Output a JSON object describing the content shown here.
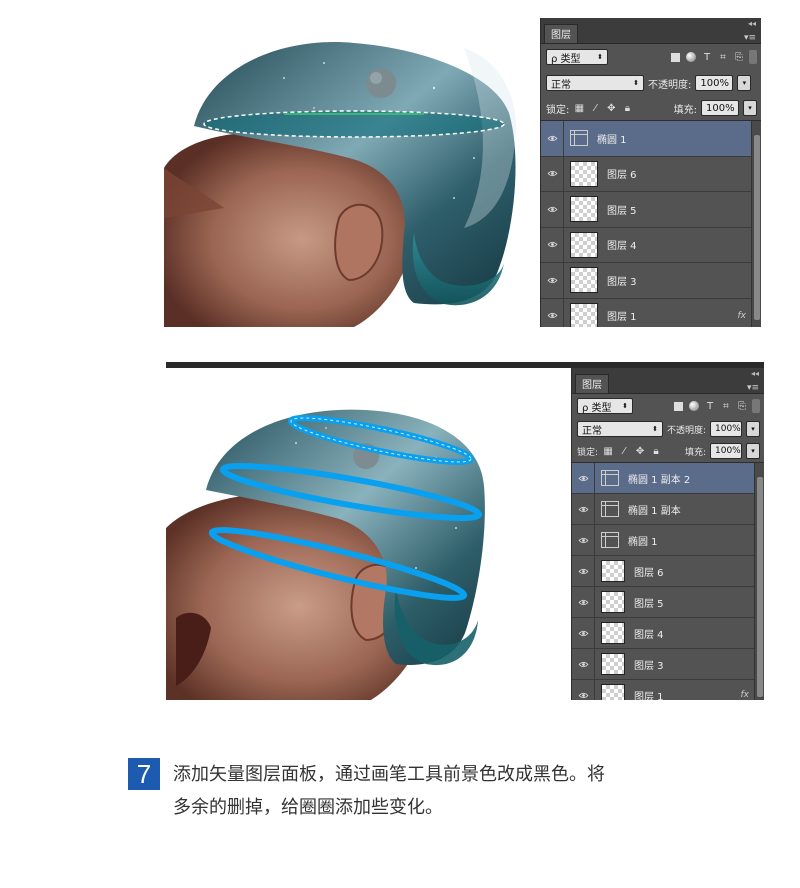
{
  "panel_top": {
    "collapse_glyph": "◂◂",
    "tab": "图层",
    "menu_glyph": "▾≡",
    "filter_label": "ρ 类型",
    "blend_mode": "正常",
    "opacity_label": "不透明度:",
    "opacity_value": "100%",
    "lock_label": "锁定:",
    "fill_label": "填充:",
    "fill_value": "100%",
    "layers": [
      {
        "name": "椭圆 1",
        "kind": "vector",
        "selected": true
      },
      {
        "name": "图层 6",
        "kind": "raster"
      },
      {
        "name": "图层 5",
        "kind": "raster"
      },
      {
        "name": "图层 4",
        "kind": "raster"
      },
      {
        "name": "图层 3",
        "kind": "raster"
      },
      {
        "name": "图层 1",
        "kind": "raster",
        "fx": "fx"
      }
    ]
  },
  "panel_bottom": {
    "collapse_glyph": "◂◂",
    "tab": "图层",
    "menu_glyph": "▾≡",
    "filter_label": "ρ 类型",
    "blend_mode": "正常",
    "opacity_label": "不透明度:",
    "opacity_value": "100%",
    "lock_label": "锁定:",
    "fill_label": "填充:",
    "fill_value": "100%",
    "layers": [
      {
        "name": "椭圆 1 副本 2",
        "kind": "vector",
        "selected": true
      },
      {
        "name": "椭圆 1 副本",
        "kind": "vector"
      },
      {
        "name": "椭圆 1",
        "kind": "vector"
      },
      {
        "name": "图层 6",
        "kind": "raster"
      },
      {
        "name": "图层 5",
        "kind": "raster"
      },
      {
        "name": "图层 4",
        "kind": "raster"
      },
      {
        "name": "图层 3",
        "kind": "raster"
      },
      {
        "name": "图层 1",
        "kind": "raster",
        "fx": "fx"
      }
    ]
  },
  "step": {
    "number": "7",
    "line1": "添加矢量图层面板，通过画笔工具前景色改成黑色。将",
    "line2": "多余的删掉，给圈圈添加些变化。"
  },
  "colors": {
    "step_badge": "#1d5bb0",
    "ring_blue": "#0aa0f0",
    "panel_bg": "#535353",
    "selected_layer": "#5b6c8a"
  }
}
